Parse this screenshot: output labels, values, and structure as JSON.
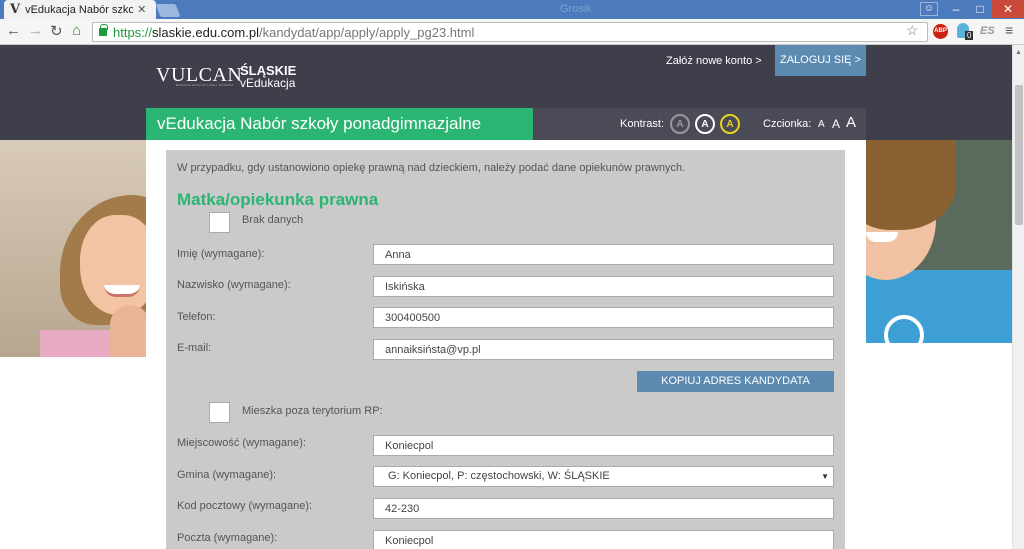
{
  "browser": {
    "tab_title": "vEdukacja Nabór szkoły p",
    "tab_close": "✕",
    "window_title": "Grosik",
    "url_scheme": "https://",
    "url_host": "slaskie.edu.com.pl",
    "url_path": "/kandydat/app/apply/apply_pg23.html",
    "ext_abp": "ABP",
    "ext_badge": "0",
    "ext_es": "ES"
  },
  "header": {
    "logo_vulcan": "VULCAN",
    "logo_vulcan_sub": "BADANIA EDUKACYJNE I ROZWÓJ",
    "logo_region": "ŚLĄSKIE",
    "logo_brand": "vEdukacja",
    "register_link": "Załóż nowe konto >",
    "login_button": "ZALOGUJ SIĘ >"
  },
  "titlebar": {
    "site_title": "vEdukacja Nabór szkoły ponadgimnazjalne",
    "contrast_label": "Kontrast:",
    "contrast_options": [
      "A",
      "A",
      "A"
    ],
    "font_label": "Czcionka:",
    "font_options": [
      "A",
      "A",
      "A"
    ]
  },
  "form": {
    "intro": "W przypadku, gdy ustanowiono opiekę prawną nad dzieckiem, należy podać dane opiekunów prawnych.",
    "section_title": "Matka/opiekunka prawna",
    "no_data_label": "Brak danych",
    "fields": {
      "first_name": {
        "label": "Imię (wymagane):",
        "value": "Anna"
      },
      "last_name": {
        "label": "Nazwisko (wymagane):",
        "value": "Iskińska"
      },
      "phone": {
        "label": "Telefon:",
        "value": "300400500"
      },
      "email": {
        "label": "E-mail:",
        "value": "annaiksiństa@vp.pl"
      },
      "city": {
        "label": "Miejscowość (wymagane):",
        "value": "Koniecpol"
      },
      "commune": {
        "label": "Gmina (wymagane):",
        "value": "G: Koniecpol, P: częstochowski, W: ŚLĄSKIE"
      },
      "postal_code": {
        "label": "Kod pocztowy (wymagane):",
        "value": "42-230"
      },
      "post_office": {
        "label": "Poczta (wymagane):",
        "value": "Koniecpol"
      }
    },
    "copy_button": "KOPIUJ ADRES KANDYDATA",
    "abroad_label": "Mieszka poza terytorium RP:"
  },
  "colors": {
    "accent_green": "#2bb573",
    "header_dark": "#3e3f4b",
    "button_blue": "#5c8ab0"
  }
}
